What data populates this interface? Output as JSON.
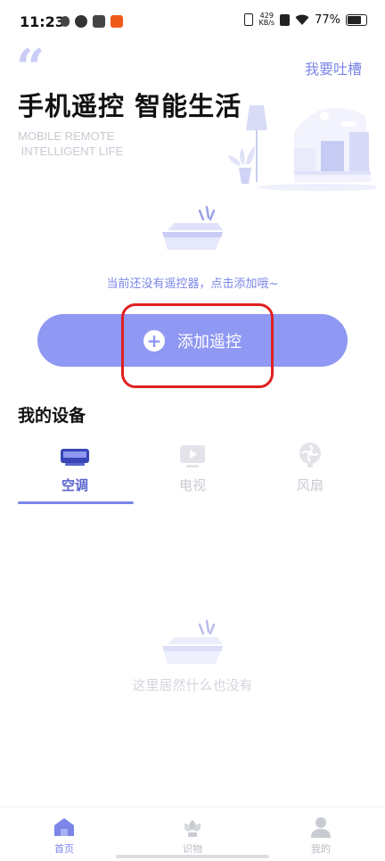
{
  "status_bar": {
    "time": "11:23",
    "net_speed_value": "429",
    "net_speed_unit": "KB/s",
    "battery": "77%",
    "battery_level": 0.77
  },
  "header": {
    "feedback_label": "我要吐槽",
    "title": "手机遥控 智能生活",
    "subtitle_line1": "MOBILE REMOTE",
    "subtitle_line2": " INTELLIGENT LIFE"
  },
  "empty_remote": {
    "tip": "当前还没有遥控器，点击添加哦~"
  },
  "add_button": {
    "label": "添加遥控"
  },
  "devices": {
    "title": "我的设备",
    "tabs": [
      {
        "label": "空调",
        "icon": "air-conditioner-icon",
        "active": true
      },
      {
        "label": "电视",
        "icon": "tv-icon",
        "active": false
      },
      {
        "label": "风扇",
        "icon": "fan-icon",
        "active": false
      }
    ],
    "empty_text": "这里居然什么也没有"
  },
  "bottom_nav": {
    "items": [
      {
        "label": "首页",
        "icon": "home-icon",
        "active": true
      },
      {
        "label": "识物",
        "icon": "flower-icon",
        "active": false
      },
      {
        "label": "我的",
        "icon": "user-icon",
        "active": false
      }
    ]
  },
  "colors": {
    "accent": "#7b86e8",
    "button": "#8f98f2",
    "highlight": "#e02020",
    "inactive": "#c9cbd3"
  }
}
